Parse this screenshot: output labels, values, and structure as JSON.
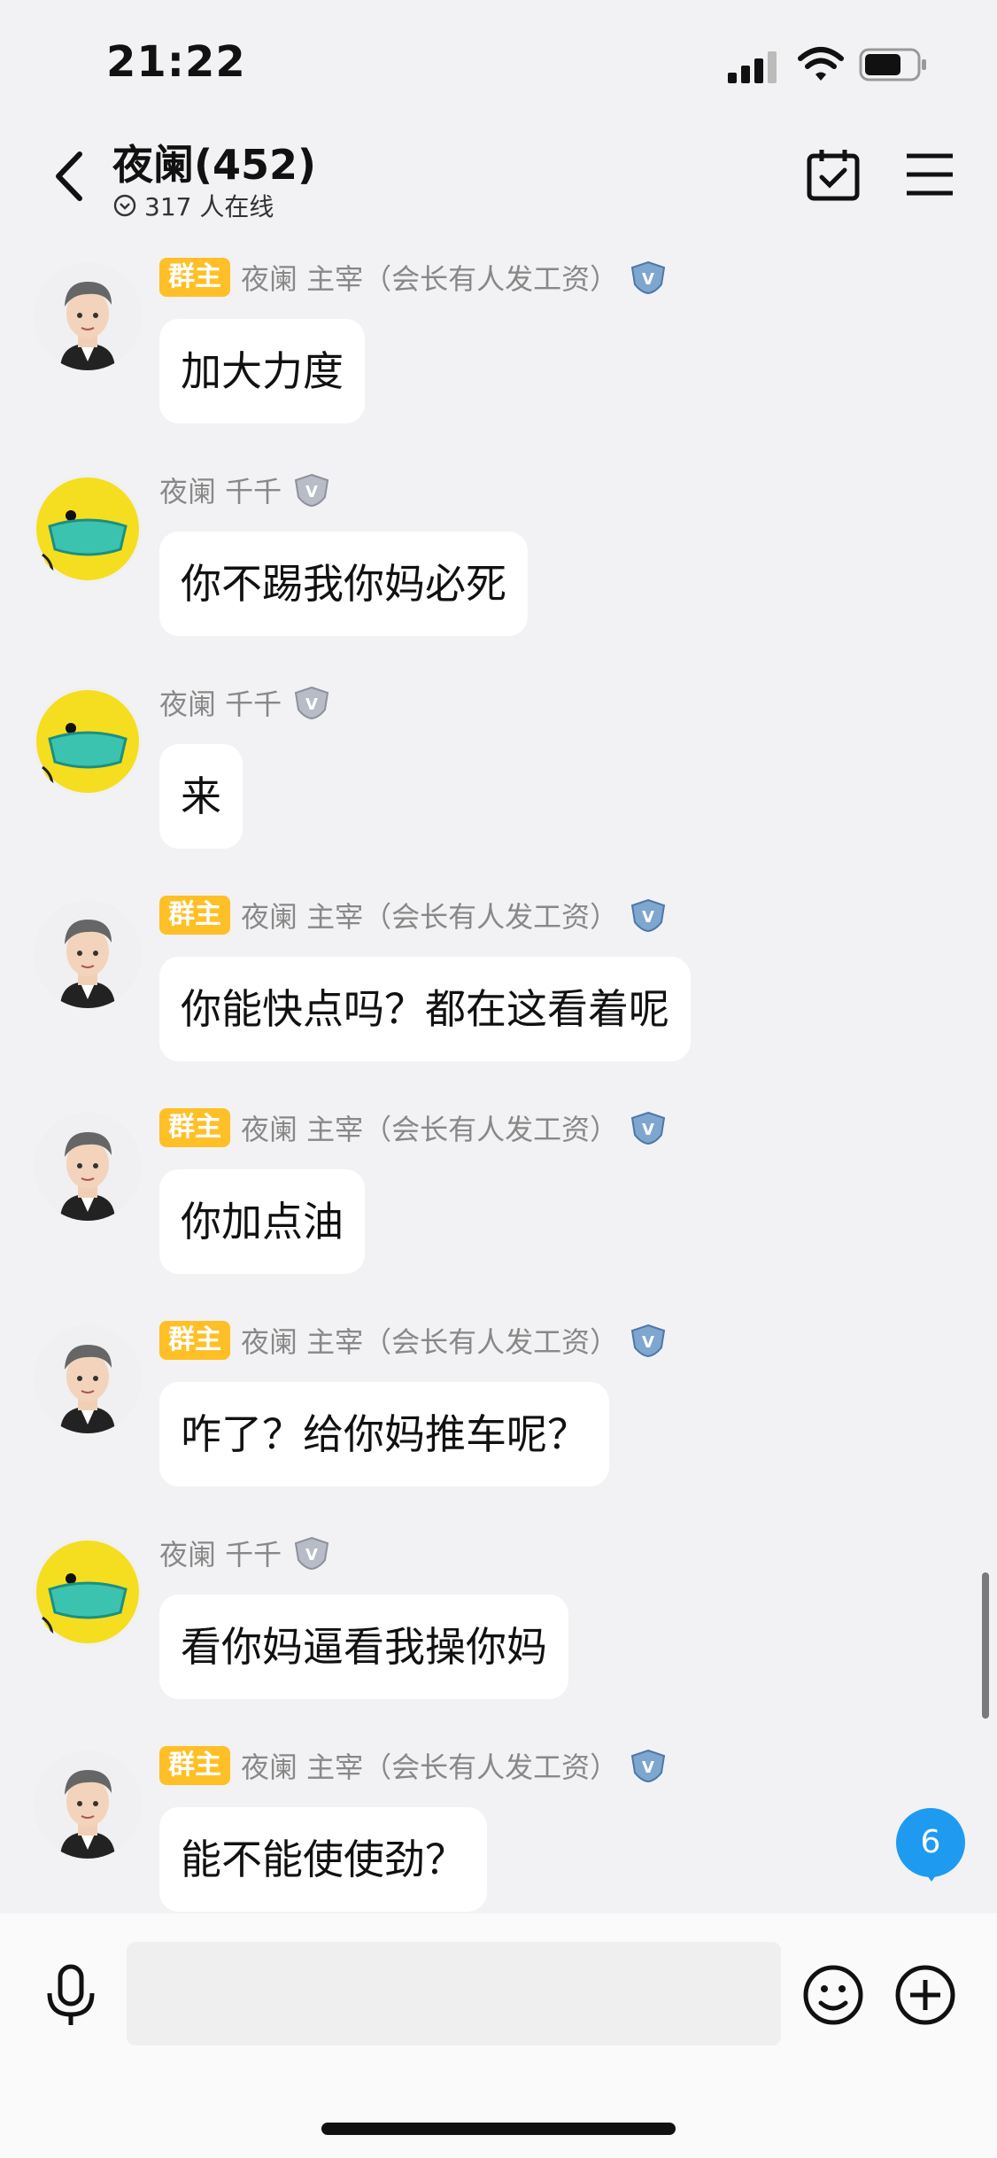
{
  "status_bar": {
    "time": "21:22"
  },
  "header": {
    "title": "夜阑(452)",
    "online": "317 人在线"
  },
  "messages": [
    {
      "sender_type": "owner",
      "badge": "群主",
      "name": "夜阑 主宰（会长有人发工资）",
      "text": "加大力度"
    },
    {
      "sender_type": "member",
      "badge": "",
      "name": "夜阑   千千",
      "text": "你不踢我你妈必死"
    },
    {
      "sender_type": "member",
      "badge": "",
      "name": "夜阑   千千",
      "text": "来"
    },
    {
      "sender_type": "owner",
      "badge": "群主",
      "name": "夜阑 主宰（会长有人发工资）",
      "text": "你能快点吗？都在这看着呢"
    },
    {
      "sender_type": "owner",
      "badge": "群主",
      "name": "夜阑 主宰（会长有人发工资）",
      "text": "你加点油"
    },
    {
      "sender_type": "owner",
      "badge": "群主",
      "name": "夜阑 主宰（会长有人发工资）",
      "text": "咋了？给你妈推车呢？"
    },
    {
      "sender_type": "member",
      "badge": "",
      "name": "夜阑   千千",
      "text": "看你妈逼看我操你妈"
    },
    {
      "sender_type": "owner",
      "badge": "群主",
      "name": "夜阑 主宰（会长有人发工资）",
      "text": "能不能使使劲？"
    }
  ],
  "unread_count": "6",
  "input": {
    "placeholder": ""
  },
  "colors": {
    "badge": "#ffbf26",
    "unread": "#1e9bf0",
    "background": "#f2f2f4"
  }
}
